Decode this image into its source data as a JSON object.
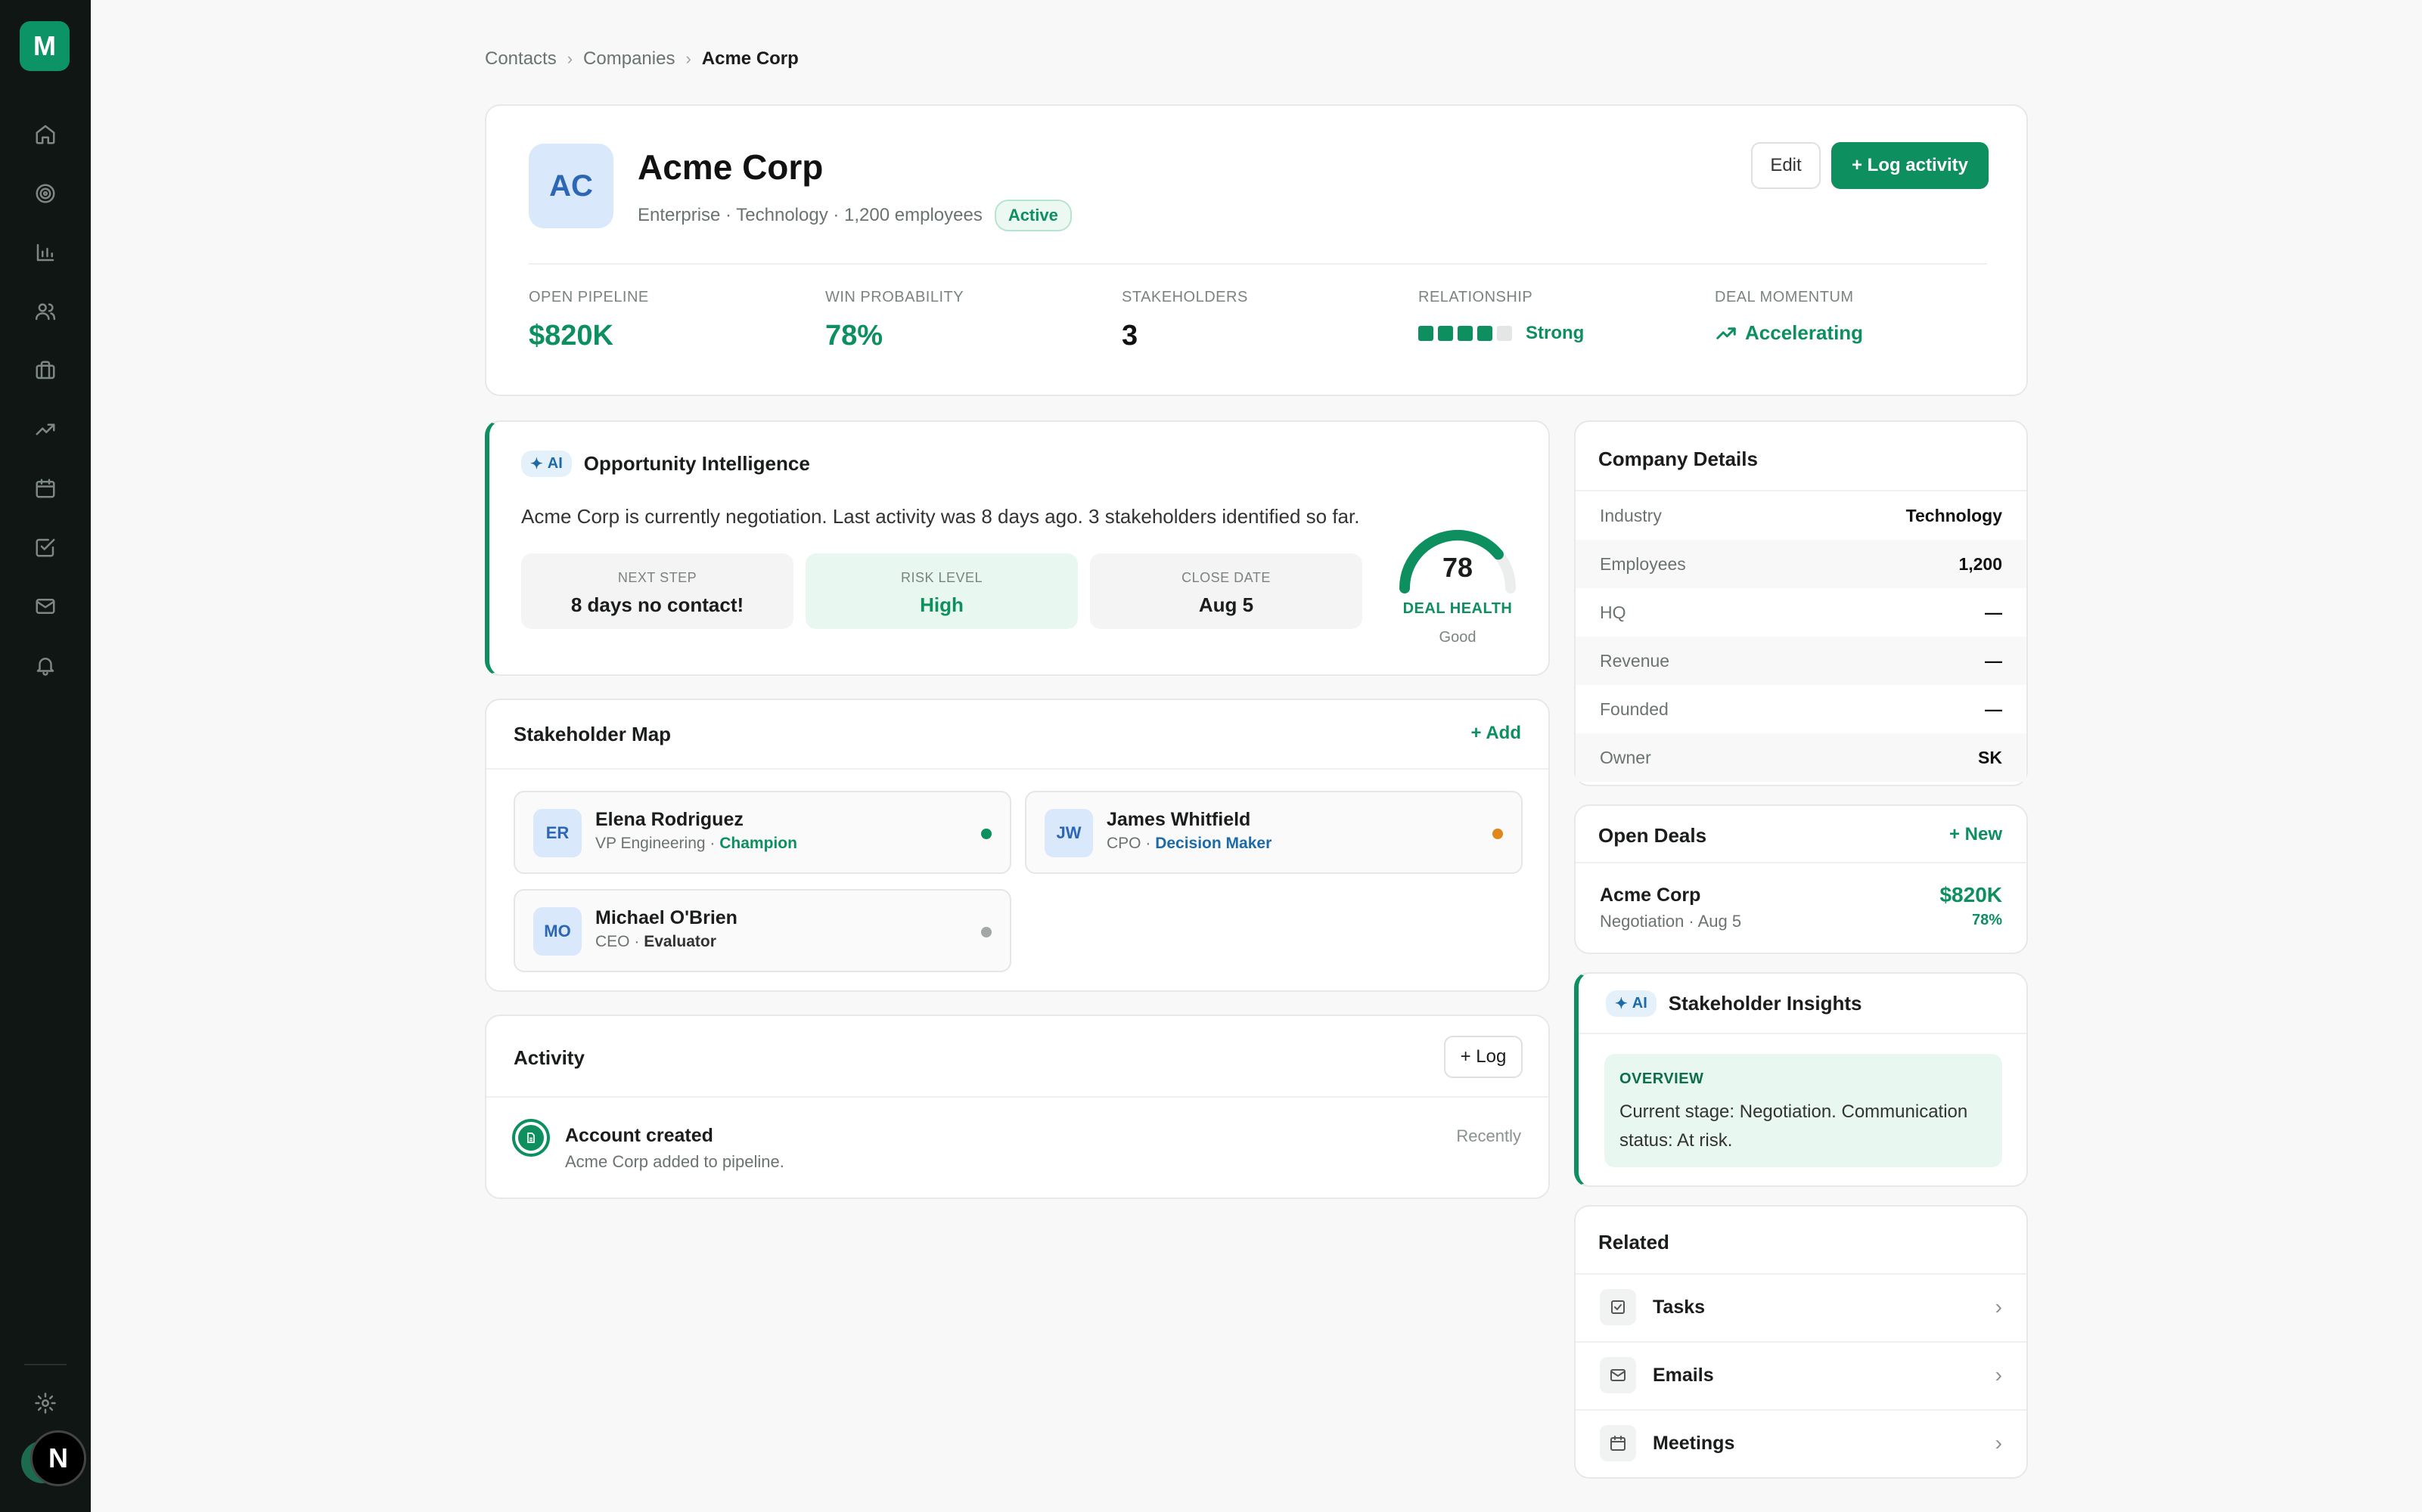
{
  "app": {
    "logo_letter": "M",
    "user_initial": "N"
  },
  "sidebar": {
    "items": [
      {
        "icon": "home-icon"
      },
      {
        "icon": "target-icon"
      },
      {
        "icon": "bar-chart-icon"
      },
      {
        "icon": "users-icon"
      },
      {
        "icon": "briefcase-icon"
      },
      {
        "icon": "trending-up-icon"
      },
      {
        "icon": "calendar-icon"
      },
      {
        "icon": "check-square-icon"
      },
      {
        "icon": "mail-icon"
      },
      {
        "icon": "bell-icon"
      }
    ],
    "settings_icon": "gear-icon"
  },
  "breadcrumb": {
    "items": [
      "Contacts",
      "Companies",
      "Acme Corp"
    ]
  },
  "company": {
    "initials": "AC",
    "name": "Acme Corp",
    "meta": "Enterprise · Technology · 1,200 employees",
    "status": "Active",
    "edit_label": "Edit",
    "log_activity_label": "+ Log activity"
  },
  "metrics": {
    "open_pipeline": {
      "label": "OPEN PIPELINE",
      "value": "$820K"
    },
    "win_probability": {
      "label": "WIN PROBABILITY",
      "value": "78%"
    },
    "stakeholders": {
      "label": "STAKEHOLDERS",
      "value": "3"
    },
    "relationship": {
      "label": "RELATIONSHIP",
      "value": "Strong",
      "level": 4,
      "max": 5
    },
    "momentum": {
      "label": "DEAL MOMENTUM",
      "value": "Accelerating"
    }
  },
  "intelligence": {
    "tag": "AI",
    "title": "Opportunity Intelligence",
    "summary": "Acme Corp is currently negotiation. Last activity was 8 days ago. 3 stakeholders identified so far.",
    "next_step": {
      "label": "NEXT STEP",
      "value": "8 days no contact!"
    },
    "risk": {
      "label": "RISK LEVEL",
      "value": "High"
    },
    "close": {
      "label": "CLOSE DATE",
      "value": "Aug 5"
    },
    "health": {
      "score": "78",
      "label": "DEAL HEALTH",
      "status": "Good",
      "fraction": 0.78
    }
  },
  "stakeholder_map": {
    "title": "Stakeholder Map",
    "add_label": "+ Add",
    "people": [
      {
        "initials": "ER",
        "name": "Elena Rodriguez",
        "title": "VP Engineering",
        "role": "Champion",
        "status_color": "#0d8f60",
        "role_color": "#0d8f60"
      },
      {
        "initials": "JW",
        "name": "James Whitfield",
        "title": "CPO",
        "role": "Decision Maker",
        "status_color": "#e0861a",
        "role_color": "#1d6aa8"
      },
      {
        "initials": "MO",
        "name": "Michael O'Brien",
        "title": "CEO",
        "role": "Evaluator",
        "status_color": "#a3a8a6",
        "role_color": "#333333"
      }
    ],
    "separator": " · "
  },
  "activity": {
    "title": "Activity",
    "log_label": "+ Log",
    "items": [
      {
        "title": "Account created",
        "subtitle": "Acme Corp added to pipeline.",
        "time": "Recently"
      }
    ]
  },
  "details": {
    "title": "Company Details",
    "rows": [
      {
        "key": "Industry",
        "value": "Technology"
      },
      {
        "key": "Employees",
        "value": "1,200"
      },
      {
        "key": "HQ",
        "value": "—"
      },
      {
        "key": "Revenue",
        "value": "—"
      },
      {
        "key": "Founded",
        "value": "—"
      },
      {
        "key": "Owner",
        "value": "SK"
      }
    ]
  },
  "open_deals": {
    "title": "Open Deals",
    "new_label": "+ New",
    "deals": [
      {
        "name": "Acme Corp",
        "sub": "Negotiation · Aug 5",
        "value": "$820K",
        "probability": "78%"
      }
    ]
  },
  "insights": {
    "tag": "AI",
    "title": "Stakeholder Insights",
    "overview_label": "OVERVIEW",
    "overview": "Current stage: Negotiation. Communication status: At risk."
  },
  "related": {
    "title": "Related",
    "items": [
      {
        "label": "Tasks",
        "icon": "check-square-icon"
      },
      {
        "label": "Emails",
        "icon": "mail-icon"
      },
      {
        "label": "Meetings",
        "icon": "calendar-icon"
      }
    ]
  },
  "colors": {
    "accent": "#0d8f60",
    "sidebar": "#0f1613",
    "ai_tag": "#1d6aa8",
    "warning": "#e0861a"
  }
}
